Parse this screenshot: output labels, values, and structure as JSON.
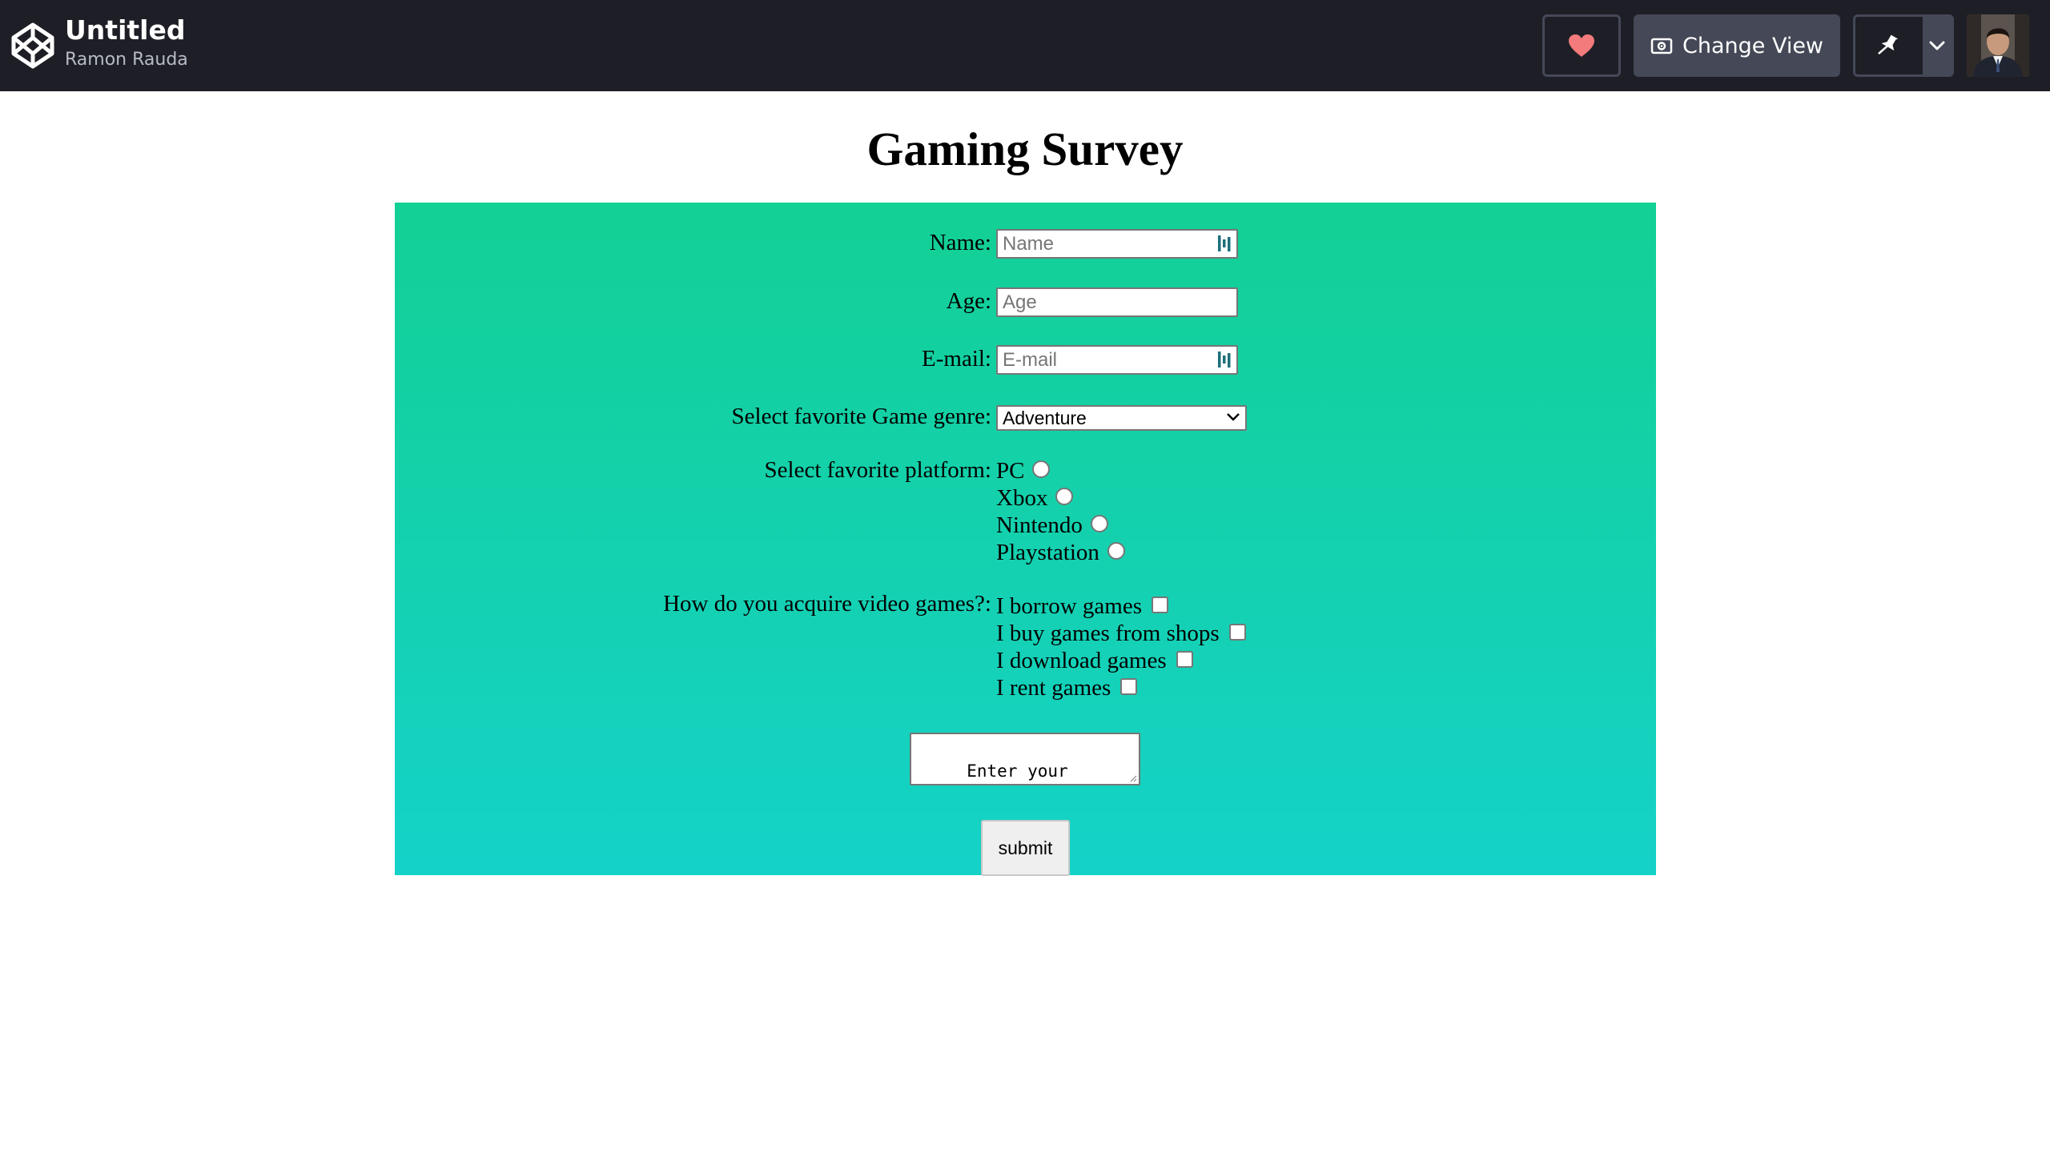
{
  "topbar": {
    "logo_icon": "codepen-logo-icon",
    "title": "Untitled",
    "author": "Ramon Rauda",
    "heart_icon": "heart-icon",
    "heart_color": "#f47b7b",
    "change_view_label": "Change View",
    "change_view_icon": "eye-icon",
    "pin_icon": "pin-icon",
    "menu_icon": "chevron-down-icon"
  },
  "page": {
    "heading": "Gaming Survey",
    "gradient_top": "#13d095",
    "gradient_bottom": "#14d2c8"
  },
  "form": {
    "name": {
      "label": "Name:",
      "placeholder": "Name",
      "value": ""
    },
    "age": {
      "label": "Age:",
      "placeholder": "Age",
      "value": ""
    },
    "email": {
      "label": "E-mail:",
      "placeholder": "E-mail",
      "value": ""
    },
    "genre": {
      "label": "Select favorite Game genre:",
      "selected": "Adventure"
    },
    "platform": {
      "label": "Select favorite platform:",
      "options": [
        {
          "label": "PC",
          "checked": false
        },
        {
          "label": "Xbox",
          "checked": false
        },
        {
          "label": "Nintendo",
          "checked": false
        },
        {
          "label": "Playstation",
          "checked": false
        }
      ]
    },
    "acquire": {
      "label": "How do you acquire video games?:",
      "options": [
        {
          "label": "I borrow games",
          "checked": false
        },
        {
          "label": "I buy games from shops",
          "checked": false
        },
        {
          "label": "I download games",
          "checked": false
        },
        {
          "label": "I rent games",
          "checked": false
        }
      ]
    },
    "comments": {
      "value": " Enter your comments here"
    },
    "submit_label": "submit"
  }
}
